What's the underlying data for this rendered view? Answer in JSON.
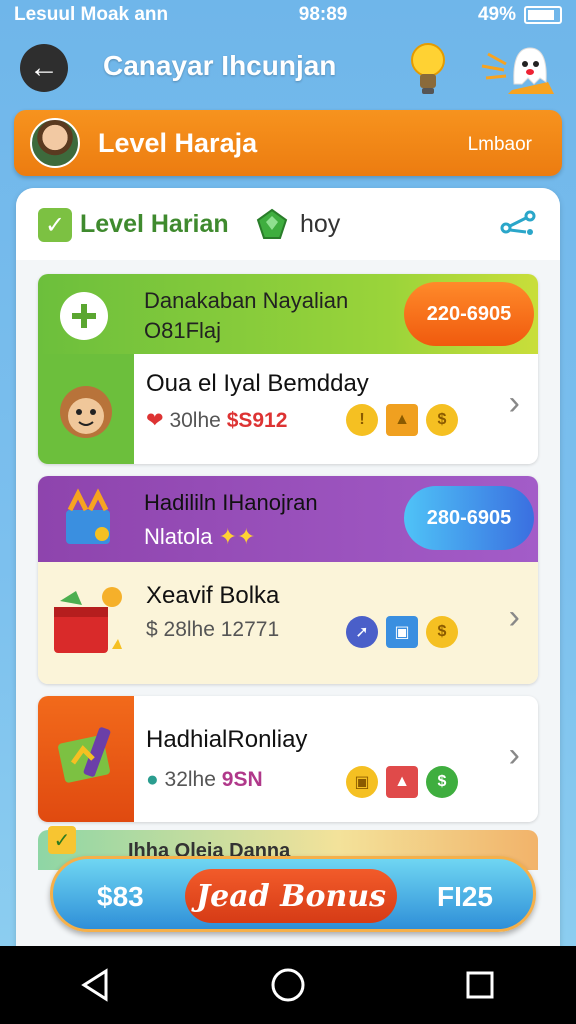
{
  "status": {
    "carrier": "Lesuul Moak ann",
    "time": "98:89",
    "battery": "49%"
  },
  "header": {
    "title": "Canayar Ihcunjan",
    "back_icon": "arrow-left-icon",
    "hint_icon": "lightbulb-icon",
    "mascot_icon": "ghost-mascot-icon"
  },
  "banner": {
    "title": "Level Haraja",
    "link": "Lmbaor"
  },
  "panel": {
    "title": "Level Harian",
    "subtitle": "hoy"
  },
  "cards": [
    {
      "strip": {
        "title": "Danakaban Nayalian",
        "subtitle": "O81Flaj",
        "pill": "220-6905"
      },
      "row": {
        "title": "Oua el Iyal Bemdday",
        "meta_prefix": "30lhe",
        "meta_value": "$S912"
      }
    },
    {
      "strip": {
        "title": "Hadililn IHanojran",
        "subtitle": "Nlatola",
        "pill": "280-6905"
      },
      "row": {
        "title": "Xeavif Bolka",
        "meta_prefix": "$ 28lhe",
        "meta_value": "12771"
      }
    },
    {
      "row": {
        "title": "HadhialRonliay",
        "meta_prefix": "32lhe",
        "meta_value": "9SN"
      }
    }
  ],
  "behind_label": "Ihha Oleia Danna",
  "bonus": {
    "left": "$83",
    "button": "Jead Bonus",
    "right": "FI25"
  },
  "colors": {
    "orange": "#f7931e",
    "green": "#7cc142",
    "purple": "#9b4fb8",
    "blue": "#2f8fd8"
  }
}
